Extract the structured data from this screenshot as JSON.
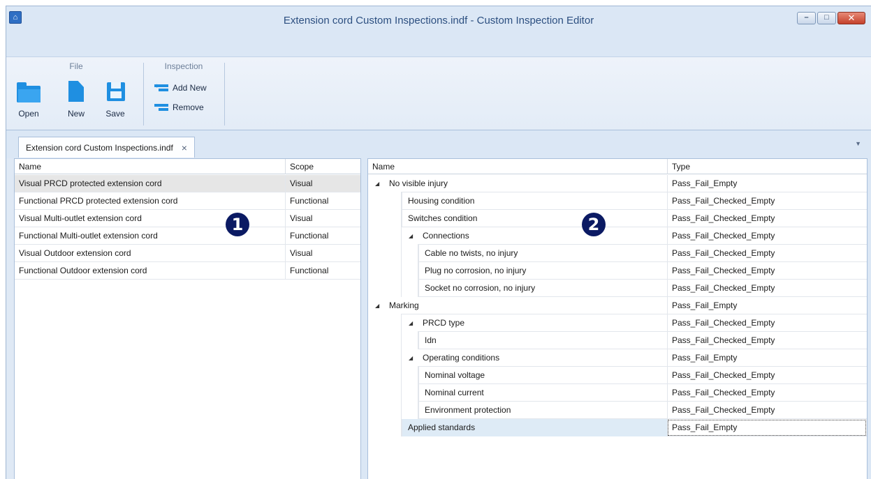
{
  "window": {
    "title": "Extension cord Custom Inspections.indf - Custom Inspection Editor",
    "controls": {
      "minimize": "–",
      "restore": "□",
      "close": "✕"
    }
  },
  "ribbon": {
    "file_group": {
      "title": "File",
      "open_label": "Open",
      "new_label": "New",
      "save_label": "Save"
    },
    "inspection_group": {
      "title": "Inspection",
      "add_new_label": "Add New",
      "remove_label": "Remove"
    }
  },
  "doc_tab": {
    "label": "Extension cord Custom Inspections.indf",
    "close": "×"
  },
  "left_pane": {
    "headers": {
      "name": "Name",
      "scope": "Scope"
    },
    "rows": [
      {
        "name": "Visual PRCD protected extension cord",
        "scope": "Visual"
      },
      {
        "name": "Functional PRCD protected extension cord",
        "scope": "Functional"
      },
      {
        "name": "Visual Multi-outlet extension cord",
        "scope": "Visual"
      },
      {
        "name": "Functional Multi-outlet extension cord",
        "scope": "Functional"
      },
      {
        "name": "Visual Outdoor extension cord",
        "scope": "Visual"
      },
      {
        "name": "Functional Outdoor extension cord",
        "scope": "Functional"
      }
    ],
    "selected_index": 0,
    "callout": "1"
  },
  "right_pane": {
    "headers": {
      "name": "Name",
      "type": "Type"
    },
    "rows": [
      {
        "name": "No visible injury",
        "type": "Pass_Fail_Empty",
        "level": 0,
        "expanded": true
      },
      {
        "name": "Housing condition",
        "type": "Pass_Fail_Checked_Empty",
        "level": 1
      },
      {
        "name": "Switches condition",
        "type": "Pass_Fail_Checked_Empty",
        "level": 1
      },
      {
        "name": "Connections",
        "type": "Pass_Fail_Checked_Empty",
        "level": 1,
        "expanded": true
      },
      {
        "name": "Cable no twists, no injury",
        "type": "Pass_Fail_Checked_Empty",
        "level": 2
      },
      {
        "name": "Plug no corrosion, no injury",
        "type": "Pass_Fail_Checked_Empty",
        "level": 2
      },
      {
        "name": "Socket no corrosion, no injury",
        "type": "Pass_Fail_Checked_Empty",
        "level": 2
      },
      {
        "name": "Marking",
        "type": "Pass_Fail_Empty",
        "level": 0,
        "expanded": true
      },
      {
        "name": "PRCD type",
        "type": "Pass_Fail_Checked_Empty",
        "level": 1,
        "expanded": true
      },
      {
        "name": "Idn",
        "type": "Pass_Fail_Checked_Empty",
        "level": 2
      },
      {
        "name": "Operating conditions",
        "type": "Pass_Fail_Empty",
        "level": 1,
        "expanded": true
      },
      {
        "name": "Nominal voltage",
        "type": "Pass_Fail_Checked_Empty",
        "level": 2
      },
      {
        "name": "Nominal current",
        "type": "Pass_Fail_Checked_Empty",
        "level": 2
      },
      {
        "name": "Environment protection",
        "type": "Pass_Fail_Checked_Empty",
        "level": 2
      },
      {
        "name": "Applied standards",
        "type": "Pass_Fail_Empty",
        "level": 1
      }
    ],
    "active_index": 14,
    "callout": "2"
  },
  "colors": {
    "accent_blue": "#1f8fe1",
    "callout_navy": "#0b1a63",
    "chrome": "#dbe7f5"
  },
  "icons": [
    "open-folder-icon",
    "new-document-icon",
    "save-disk-icon",
    "add-row-icon",
    "remove-row-icon",
    "expand-triangle-icon"
  ]
}
